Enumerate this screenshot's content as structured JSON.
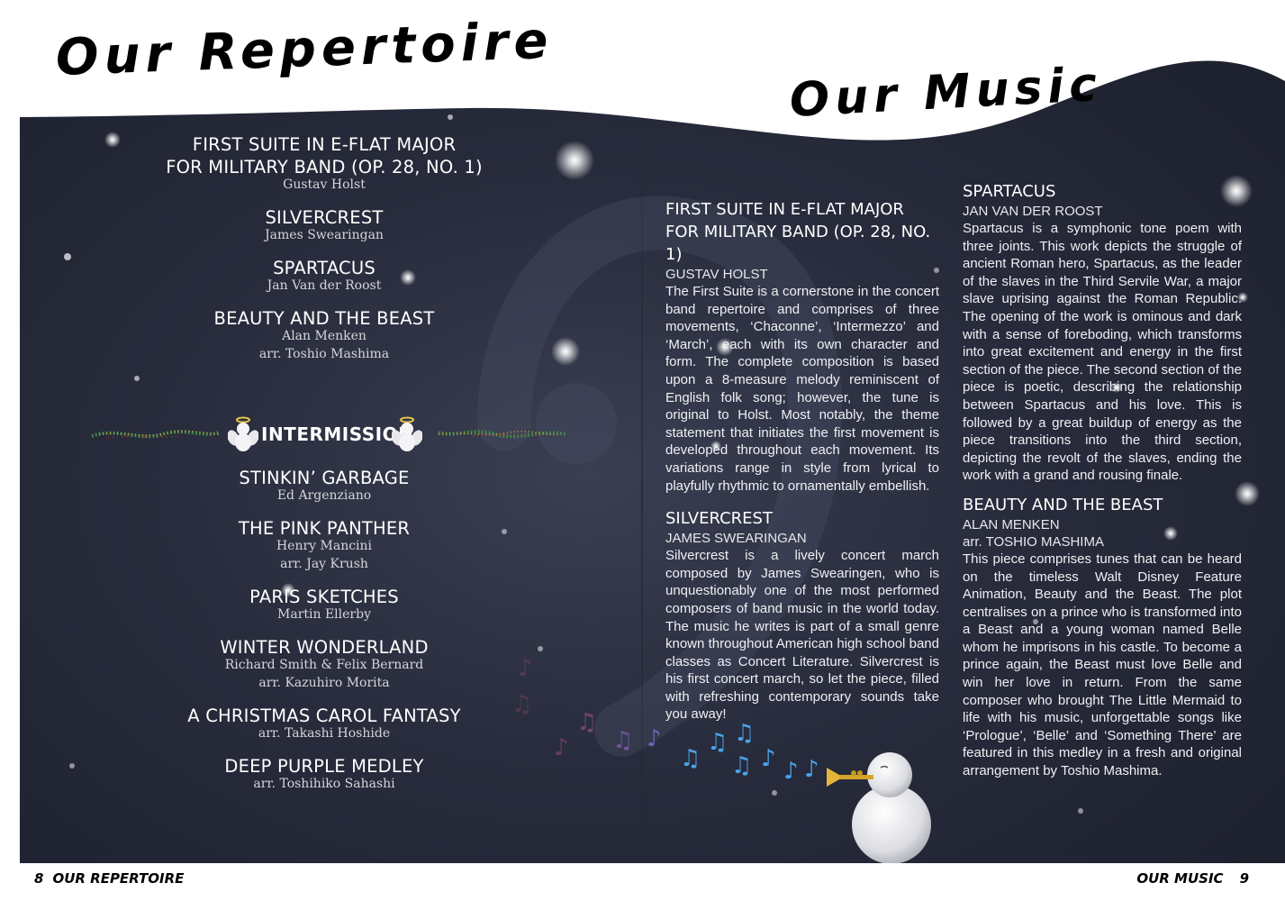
{
  "titles": {
    "left": "Our Repertoire",
    "right": "Our Music"
  },
  "program": {
    "first_half": [
      {
        "title": "FIRST SUITE IN E-FLAT MAJOR",
        "title_line2": "FOR MILITARY BAND (OP. 28, NO. 1)",
        "credits": [
          "Gustav Holst"
        ]
      },
      {
        "title": "SILVERCREST",
        "credits": [
          "James Swearingan"
        ]
      },
      {
        "title": "SPARTACUS",
        "credits": [
          "Jan Van der Roost"
        ]
      },
      {
        "title": "BEAUTY AND THE BEAST",
        "credits": [
          "Alan Menken",
          "arr. Toshio Mashima"
        ]
      }
    ],
    "intermission_label": "INTERMISSION",
    "second_half": [
      {
        "title": "STINKIN’ GARBAGE",
        "credits": [
          "Ed Argenziano"
        ]
      },
      {
        "title": "THE PINK PANTHER",
        "credits": [
          "Henry Mancini",
          "arr. Jay Krush"
        ]
      },
      {
        "title": "PARIS SKETCHES",
        "credits": [
          "Martin Ellerby"
        ]
      },
      {
        "title": "WINTER WONDERLAND",
        "credits": [
          "Richard Smith & Felix Bernard",
          "arr. Kazuhiro Morita"
        ]
      },
      {
        "title": "A CHRISTMAS CAROL FANTASY",
        "credits": [
          "arr. Takashi Hoshide"
        ]
      },
      {
        "title": "DEEP PURPLE MEDLEY",
        "credits": [
          "arr. Toshihiko Sahashi"
        ]
      }
    ]
  },
  "articles": {
    "middle": [
      {
        "title": "FIRST SUITE IN E-FLAT MAJOR FOR MILITARY BAND (OP. 28, NO. 1)",
        "subtitles": [
          "GUSTAV HOLST"
        ],
        "body": "The First Suite is a cornerstone in the concert band repertoire and comprises of three movements, ‘Chaconne’, ‘Intermezzo’ and ‘March’, each with its own character and form. The complete composition is based upon a 8-measure melody reminiscent of English folk song; however, the tune is original to Holst. Most notably, the theme statement that initiates the first movement is developed throughout each movement. Its variations range in style from lyrical to playfully rhythmic to ornamentally embellish."
      },
      {
        "title": "SILVERCREST",
        "subtitles": [
          "JAMES SWEARINGAN"
        ],
        "body": "Silvercrest is a lively concert march composed by James Swearingen, who is unquestionably one of the most performed composers of band music in the world today. The music he writes is part of a small genre known throughout American high school band classes as Concert Literature. Silvercrest is his first concert march, so let the piece, filled with refreshing contemporary sounds take you away!"
      }
    ],
    "right": [
      {
        "title": "SPARTACUS",
        "subtitles": [
          "JAN VAN DER ROOST"
        ],
        "body": "Spartacus is a symphonic tone poem with three joints. This work depicts the struggle of ancient Roman hero, Spartacus, as the leader of the slaves in the Third Servile War, a major slave uprising against the Roman Republic. The opening of the work is ominous and dark with a sense of foreboding, which transforms into great excitement and energy in the first section of the piece. The second section of the piece is poetic, describing the relationship between Spartacus and his love. This is followed by a great buildup of energy as the piece transitions into the third section, depicting the revolt of the slaves, ending the work with a grand and rousing finale."
      },
      {
        "title": "BEAUTY AND THE BEAST",
        "subtitles": [
          "ALAN MENKEN",
          "arr. TOSHIO MASHIMA"
        ],
        "body": "This piece comprises tunes that can be heard on the timeless Walt Disney Feature Animation, Beauty and the Beast. The plot centralises on a prince who is transformed into a Beast and a young woman named Belle whom he imprisons in his castle. To become a prince again, the Beast must love Belle and win her love in return. From the same composer who brought The Little Mermaid to life with his music, unforgettable songs like ‘Prologue’, ‘Belle’ and ‘Something There’ are featured in this medley in a fresh and original arrangement by Toshio Mashima."
      }
    ]
  },
  "footer": {
    "left_number": "8",
    "left_label": "OUR REPERTOIRE",
    "right_label": "OUR MUSIC",
    "right_number": "9"
  },
  "icons": [
    "star-icon",
    "angel-icon",
    "snowman-icon",
    "trumpet-icon",
    "music-note-icon",
    "bass-clef-icon"
  ],
  "colors": {
    "sky": "#272b3b",
    "text": "#ffffff",
    "notes_blue": "#4aa3e8",
    "notes_purple": "#8a5fb0"
  }
}
